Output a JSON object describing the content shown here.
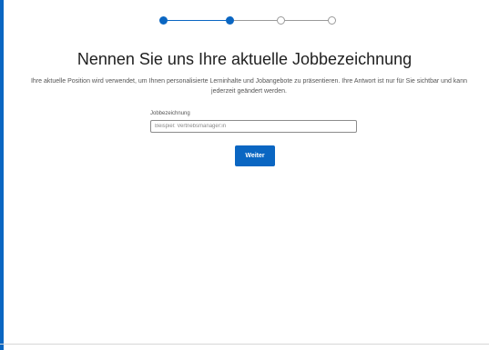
{
  "colors": {
    "accent": "#0a66c2",
    "step_todo": "#9a9a9a",
    "text_primary": "#1f1f1f",
    "text_secondary": "#555555"
  },
  "stepper": {
    "steps": [
      {
        "state": "done"
      },
      {
        "state": "done"
      },
      {
        "state": "todo"
      },
      {
        "state": "todo"
      }
    ]
  },
  "page": {
    "title": "Nennen Sie uns Ihre aktuelle Jobbezeichnung",
    "subtitle": "Ihre aktuelle Position wird verwendet, um Ihnen personalisierte Lerninhalte und Jobangebote zu präsentieren. Ihre Antwort ist nur für Sie sichtbar und kann jederzeit geändert werden."
  },
  "form": {
    "job_title_label": "Jobbezeichnung",
    "job_title_placeholder": "Beispiel: Vertriebsmanager:in",
    "job_title_value": "",
    "next_label": "Weiter"
  }
}
